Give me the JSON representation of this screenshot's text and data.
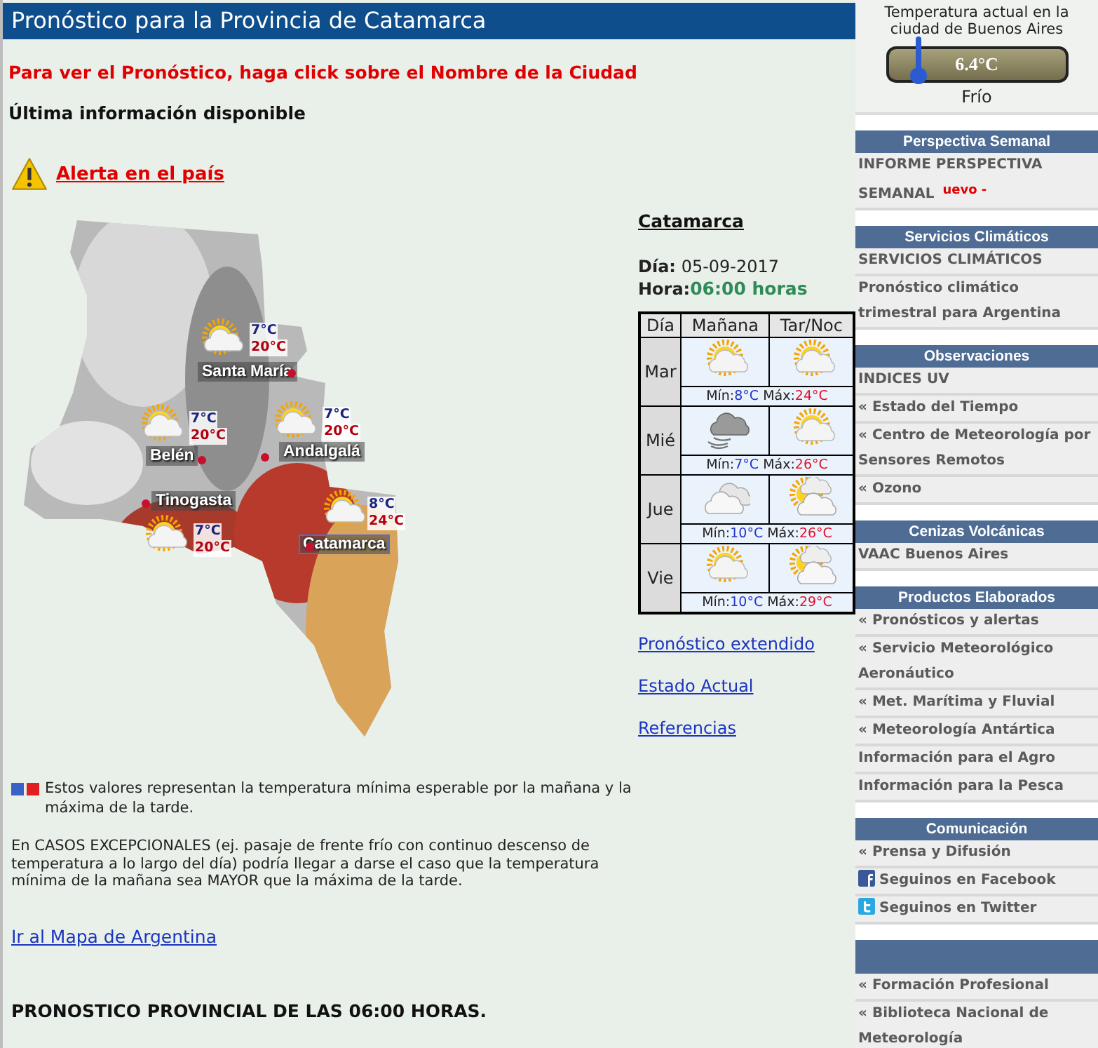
{
  "header": {
    "title": "Pronóstico para la Provincia de Catamarca"
  },
  "instruction": "Para ver el Pronóstico, haga click sobre el Nombre de la Ciudad",
  "subtitle": "Última información disponible",
  "alert_link": "Alerta en el país",
  "map": {
    "cities": [
      {
        "name": "Santa María",
        "min": "7°C",
        "max": "20°C",
        "selected": false
      },
      {
        "name": "Belén",
        "min": "7°C",
        "max": "20°C",
        "selected": false
      },
      {
        "name": "Andalgalá",
        "min": "7°C",
        "max": "20°C",
        "selected": false
      },
      {
        "name": "Tinogasta",
        "min": "7°C",
        "max": "20°C",
        "selected": false
      },
      {
        "name": "Catamarca",
        "min": "8°C",
        "max": "24°C",
        "selected": true
      }
    ]
  },
  "forecast": {
    "city": "Catamarca",
    "date_label": "Día:",
    "date": "05-09-2017",
    "time_label": "Hora:",
    "time": "06:00 horas",
    "columns": [
      "Día",
      "Mañana",
      "Tar/Noc"
    ],
    "rows": [
      {
        "day": "Mar",
        "morning": {
          "kind": "sun-cloud"
        },
        "evening": {
          "kind": "sun-cloud"
        },
        "min_label": "Mín:",
        "min": "8°C",
        "max_label": "Máx:",
        "max": "24°C"
      },
      {
        "day": "Mié",
        "morning": {
          "kind": "rain-wind"
        },
        "evening": {
          "kind": "sun-cloud"
        },
        "min_label": "Mín:",
        "min": "7°C",
        "max_label": "Máx:",
        "max": "26°C"
      },
      {
        "day": "Jue",
        "morning": {
          "kind": "clouds"
        },
        "evening": {
          "kind": "sun-clouds"
        },
        "min_label": "Mín:",
        "min": "10°C",
        "max_label": "Máx:",
        "max": "26°C"
      },
      {
        "day": "Vie",
        "morning": {
          "kind": "sun-cloud"
        },
        "evening": {
          "kind": "sun-clouds"
        },
        "min_label": "Mín:",
        "min": "10°C",
        "max_label": "Máx:",
        "max": "29°C"
      }
    ],
    "links": [
      "Pronóstico extendido",
      "Estado Actual",
      "Referencias"
    ]
  },
  "legend": "Estos valores representan la temperatura mínima esperable por la mañana y la máxima de la tarde.",
  "note": "En CASOS EXCEPCIONALES (ej. pasaje de frente frío con continuo descenso de temperatura a lo largo del día) podría llegar a darse el caso que la temperatura mínima de la mañana sea MAYOR que la máxima de la tarde.",
  "map_link": "Ir al Mapa de Argentina",
  "footer_heading": "PRONOSTICO PROVINCIAL DE LAS 06:00 HORAS.",
  "sidebar": {
    "widget": {
      "caption": "Temperatura actual en la ciudad de Buenos Aires",
      "temperature": "6.4°C",
      "condition": "Frío"
    },
    "sections": [
      {
        "title": "Perspectiva Semanal",
        "items": [
          {
            "kind": "text",
            "text": "INFORME PERSPECTIVA SEMANAL",
            "badge": "uevo -"
          }
        ]
      },
      {
        "title": "Servicios Climáticos",
        "items": [
          {
            "kind": "text",
            "text": "SERVICIOS CLIMÁTICOS"
          },
          {
            "kind": "text",
            "text": "Pronóstico climático trimestral para Argentina"
          }
        ]
      },
      {
        "title": "Observaciones",
        "items": [
          {
            "kind": "text",
            "text": "INDICES UV"
          },
          {
            "kind": "text",
            "text": "« Estado del Tiempo"
          },
          {
            "kind": "text",
            "text": "« Centro de Meteorología por Sensores Remotos"
          },
          {
            "kind": "text",
            "text": "« Ozono"
          }
        ]
      },
      {
        "title": "Cenizas Volcánicas",
        "items": [
          {
            "kind": "text",
            "text": "VAAC Buenos Aires"
          }
        ]
      },
      {
        "title": "Productos Elaborados",
        "items": [
          {
            "kind": "text",
            "text": "« Pronósticos y alertas"
          },
          {
            "kind": "text",
            "text": "« Servicio Meteorológico Aeronáutico"
          },
          {
            "kind": "text",
            "text": "« Met. Marítima y Fluvial"
          },
          {
            "kind": "text",
            "text": "« Meteorología Antártica"
          },
          {
            "kind": "text",
            "text": "Información para el Agro"
          },
          {
            "kind": "text",
            "text": "Información para la Pesca"
          }
        ]
      },
      {
        "title": "Comunicación",
        "items": [
          {
            "kind": "text",
            "text": "« Prensa y Difusión"
          },
          {
            "kind": "facebook",
            "text": "Seguinos en Facebook"
          },
          {
            "kind": "twitter",
            "text": "Seguinos en Twitter"
          }
        ]
      },
      {
        "items": [
          {
            "kind": "text",
            "text": "« Formación Profesional"
          },
          {
            "kind": "text",
            "text": "« Biblioteca Nacional de Meteorología"
          }
        ]
      }
    ]
  }
}
